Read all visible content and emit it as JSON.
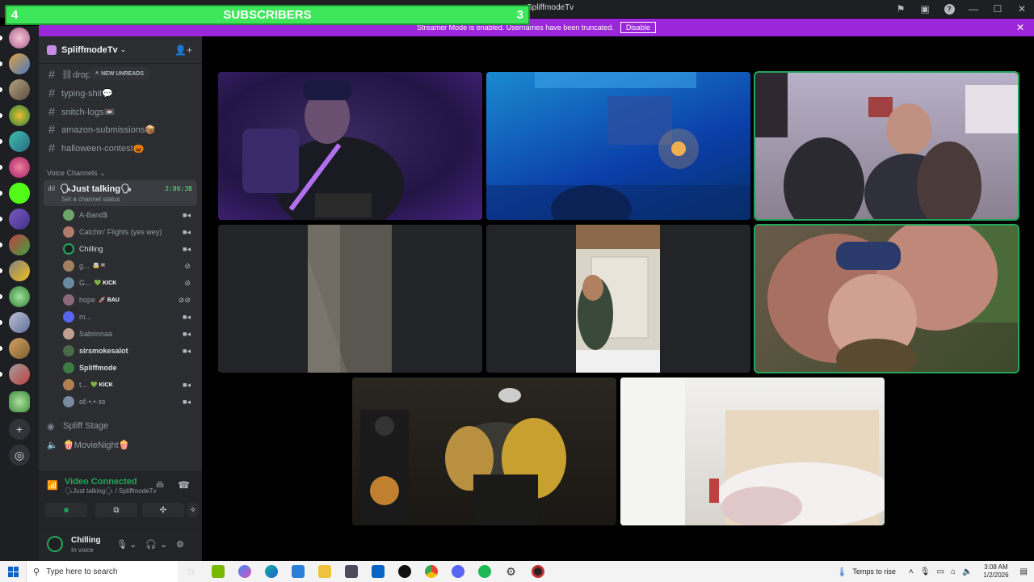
{
  "window": {
    "title": "SpliffmodeTv"
  },
  "overlay": {
    "left_count": "4",
    "label": "SUBSCRIBERS",
    "right_count": "3"
  },
  "banner": {
    "message": "Streamer Mode is enabled. Usernames have been truncated.",
    "disable_label": "Disable"
  },
  "guild": {
    "name": "SpliffmodeTv"
  },
  "channels": {
    "text": [
      {
        "name": "⛓drop"
      },
      {
        "name": "typing-shit💬"
      },
      {
        "name": "snitch-logs📼"
      },
      {
        "name": "amazon-submissions📦"
      },
      {
        "name": "halloween-contest🎃"
      }
    ],
    "new_unreads": "NEW UNREADS",
    "voice_category": "Voice Channels",
    "active_voice": {
      "name": "🗣Just talking🗣",
      "status": "Set a channel status",
      "timer": "2:06:38"
    },
    "members": [
      {
        "name": "A-Band$",
        "badge": "",
        "color": "#6ea56a"
      },
      {
        "name": "Catchin' Flights (yes wey)",
        "badge": "",
        "color": "#b07a6a"
      },
      {
        "name": "Chilling",
        "badge": "",
        "color": "#3a7a4a"
      },
      {
        "name": "g...",
        "badge": "🤯 ᵗᵗᵗ",
        "color": "#a08060"
      },
      {
        "name": "G...",
        "badge": "💚 KICK",
        "color": "#6a8aa0"
      },
      {
        "name": "hope",
        "badge": "🚀 BAU",
        "color": "#8a6a7a"
      },
      {
        "name": "m...",
        "badge": "",
        "color": "#5865f2"
      },
      {
        "name": "Sabrinnaa",
        "badge": "",
        "color": "#c0a090"
      },
      {
        "name": "sirsmokesalot",
        "badge": "",
        "color": "#4a6a4a"
      },
      {
        "name": "Spliffmode",
        "badge": "",
        "color": "#3e7a44"
      },
      {
        "name": "t...",
        "badge": "💚 KICK",
        "color": "#b08050"
      },
      {
        "name": "ɞɛ̃·•.•·ɜɞ",
        "badge": "",
        "color": "#7a8aa0"
      }
    ],
    "other_voice": [
      {
        "name": "Spliff Stage",
        "icon": "stage-icon"
      },
      {
        "name": "🍿MovieNight🍿",
        "icon": "speaker-icon"
      }
    ]
  },
  "voice_panel": {
    "title": "Video Connected",
    "subtitle": "🗣Just talking🗣 / SpliffmodeTv"
  },
  "user_panel": {
    "name": "Chilling",
    "status": "In voice"
  },
  "video_tiles": [
    {
      "id": "tile-1",
      "speaking": false
    },
    {
      "id": "tile-2",
      "speaking": false
    },
    {
      "id": "tile-3",
      "speaking": true
    },
    {
      "id": "tile-4",
      "speaking": false
    },
    {
      "id": "tile-5",
      "speaking": false
    },
    {
      "id": "tile-6",
      "speaking": true
    },
    {
      "id": "tile-7",
      "speaking": false
    },
    {
      "id": "tile-8",
      "speaking": false
    }
  ],
  "taskbar": {
    "search_placeholder": "Type here to search",
    "weather": "Temps to rise",
    "time": "3:08 AM",
    "date": "1/2/2026"
  },
  "colors": {
    "accent_green": "#23a55a",
    "banner_purple": "#9c26d9",
    "overlay_green": "#3ee65a"
  }
}
